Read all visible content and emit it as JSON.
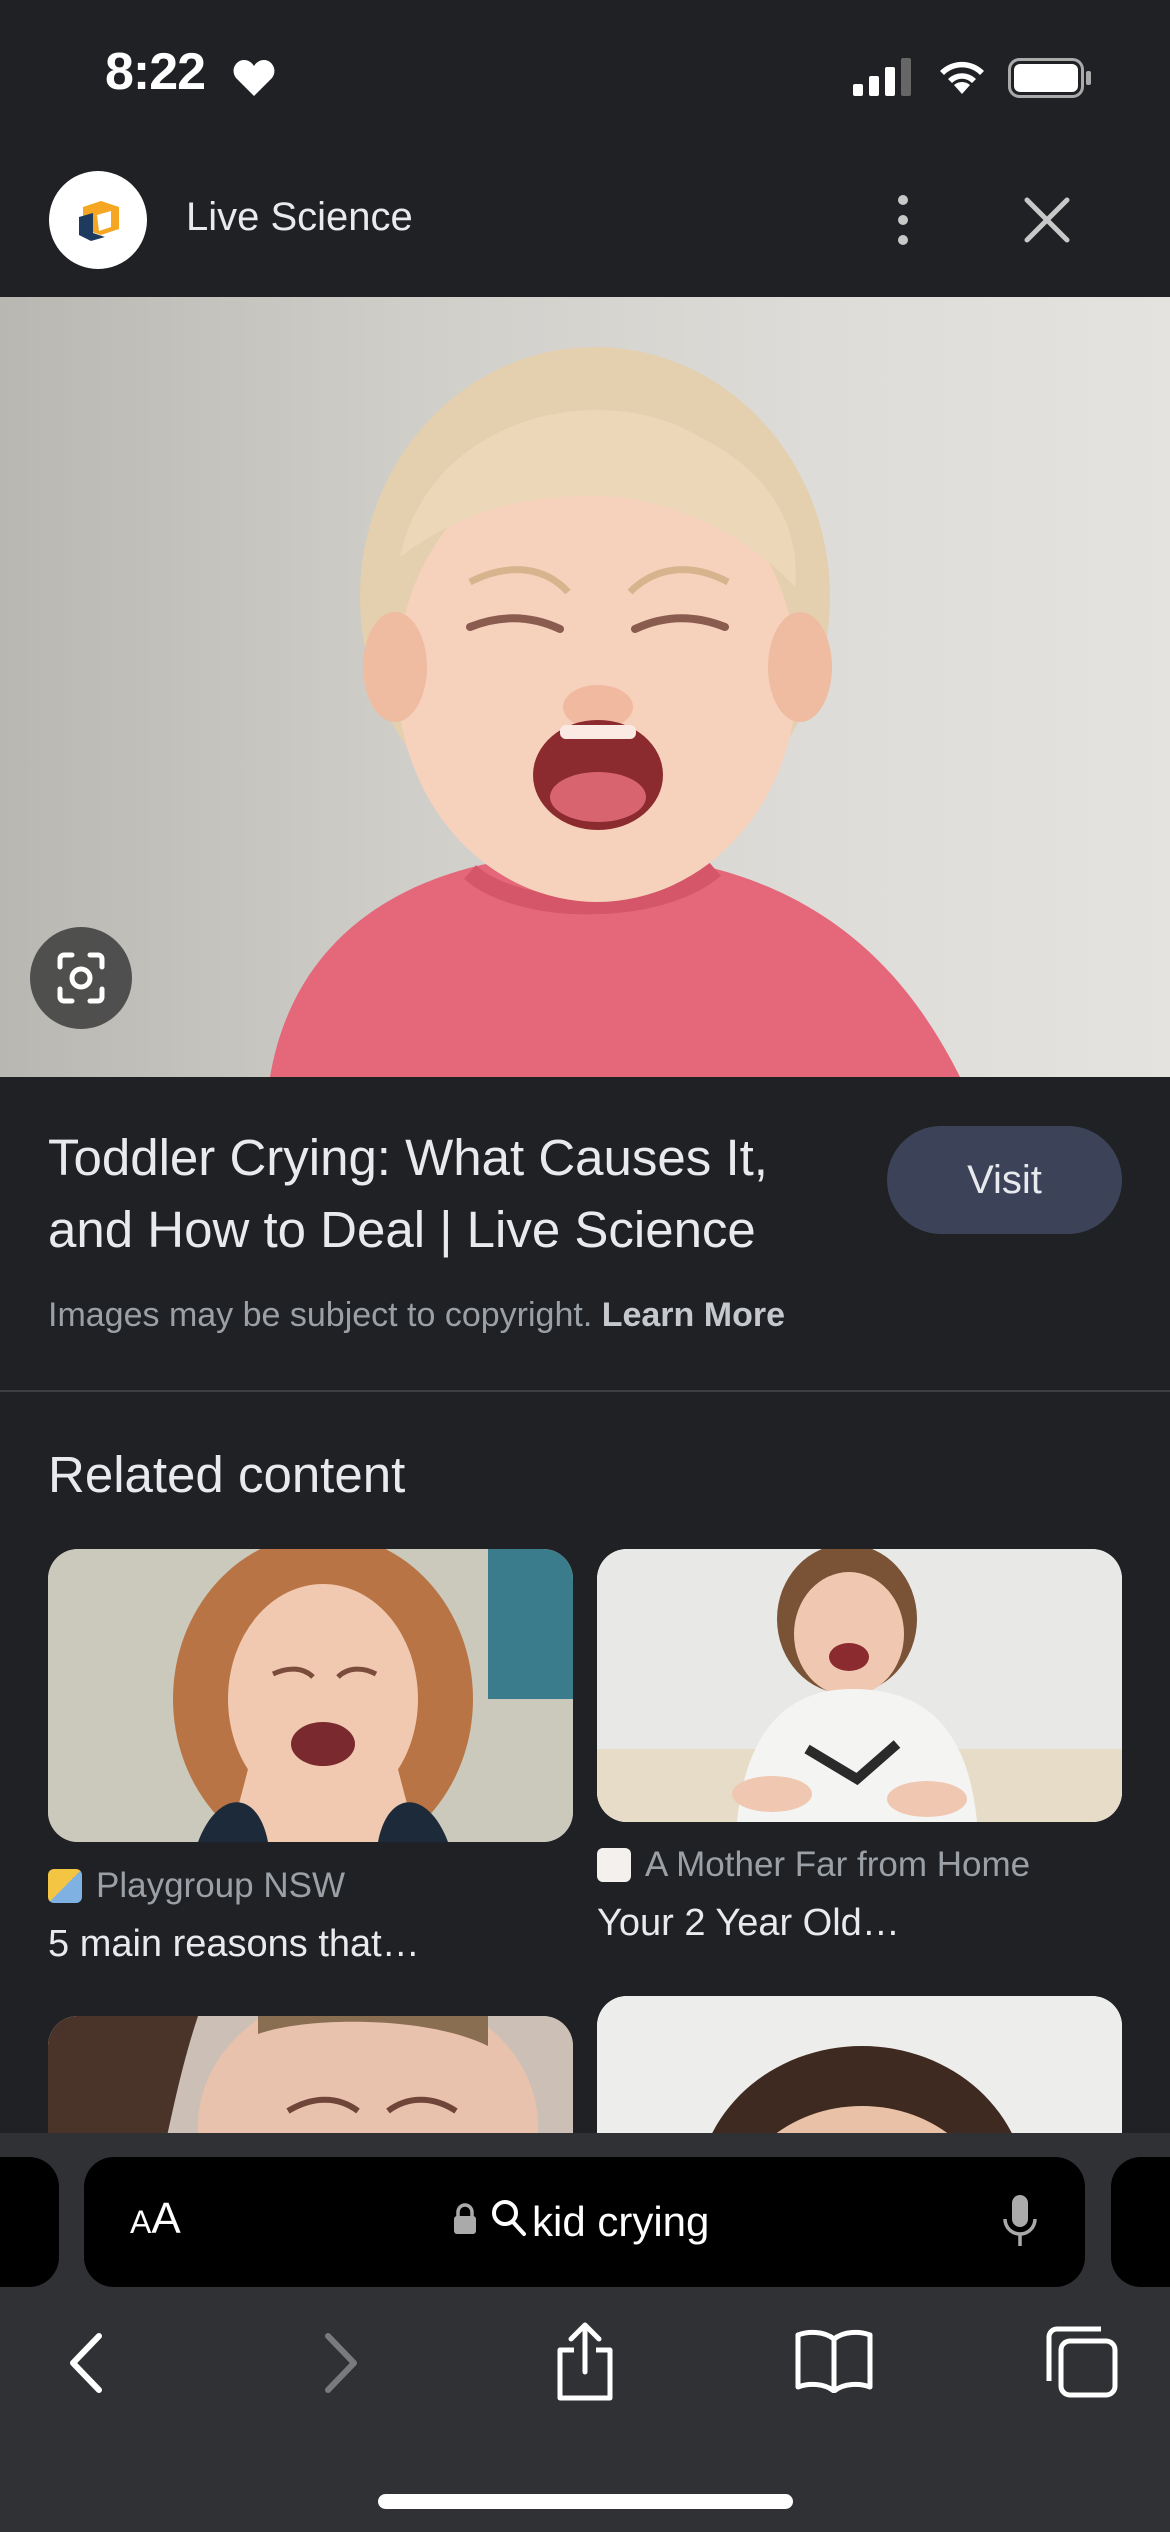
{
  "status_bar": {
    "time": "8:22",
    "icons": [
      "heart-icon",
      "signal-icon",
      "wifi-icon",
      "battery-icon"
    ]
  },
  "header": {
    "site_name": "Live Science",
    "logo_icon": "live-science-logo-icon",
    "menu_icon": "more-vertical-icon",
    "close_icon": "close-icon"
  },
  "image": {
    "lens_icon": "lens-icon"
  },
  "result": {
    "title": "Toddler Crying: What Causes It, and How to Deal | Live Science",
    "visit_label": "Visit",
    "copyright_text": "Images may be subject to copyright.",
    "learn_more": "Learn More"
  },
  "related": {
    "heading": "Related content",
    "items": [
      {
        "source": "Playgroup NSW",
        "title": "5 main reasons that…"
      },
      {
        "source": "A Mother Far from Home",
        "title": "Your 2 Year Old…"
      }
    ]
  },
  "toolbar": {
    "aa_label": "AA",
    "query": "kid crying",
    "icons": [
      "lock-icon",
      "search-icon",
      "microphone-icon",
      "back-icon",
      "forward-icon",
      "share-icon",
      "bookmarks-icon",
      "tabs-icon"
    ]
  },
  "colors": {
    "background": "#202124",
    "toolbar": "#303134",
    "visit_button": "#3c4358",
    "text": "#e8eaed",
    "muted": "#9aa0a6"
  }
}
